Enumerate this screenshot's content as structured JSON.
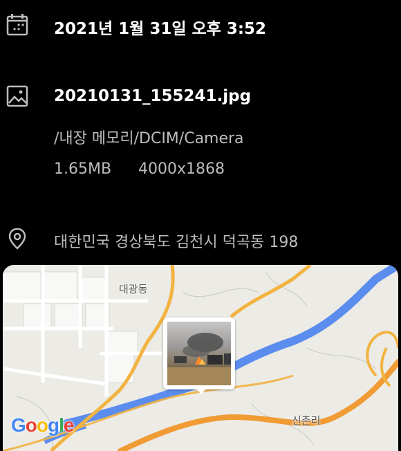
{
  "datetime": {
    "icon": "calendar-icon",
    "text": "2021년 1월 31일 오후 3:52"
  },
  "file": {
    "icon": "image-icon",
    "name": "20210131_155241.jpg",
    "path": "/내장 메모리/DCIM/Camera",
    "size": "1.65MB",
    "resolution": "4000x1868"
  },
  "location": {
    "icon": "location-pin-icon",
    "address": "대한민국 경상북도 김천시 덕곡동 198"
  },
  "map": {
    "labels": {
      "top": "대광동",
      "bottom_right": "신촌리"
    },
    "attribution": [
      "G",
      "o",
      "o",
      "g",
      "l",
      "e"
    ],
    "colors": {
      "road_major": "#f2b340",
      "road_highway": "#f09b34",
      "river": "#5b8def",
      "land": "#ecebe6"
    }
  }
}
